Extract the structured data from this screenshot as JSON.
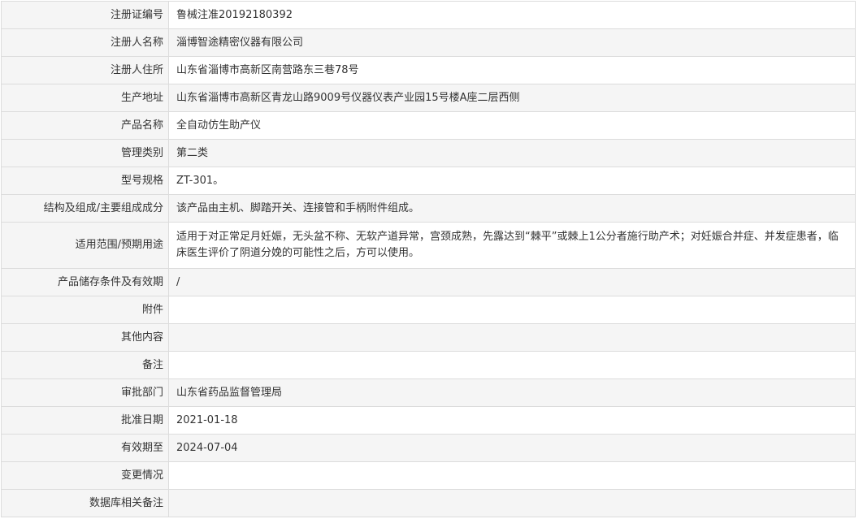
{
  "rows": [
    {
      "label": "注册证编号",
      "value": "鲁械注准20192180392"
    },
    {
      "label": "注册人名称",
      "value": "淄博智途精密仪器有限公司"
    },
    {
      "label": "注册人住所",
      "value": "山东省淄博市高新区南营路东三巷78号"
    },
    {
      "label": "生产地址",
      "value": "山东省淄博市高新区青龙山路9009号仪器仪表产业园15号楼A座二层西侧"
    },
    {
      "label": "产品名称",
      "value": "全自动仿生助产仪"
    },
    {
      "label": "管理类别",
      "value": "第二类"
    },
    {
      "label": "型号规格",
      "value": "ZT-301。"
    },
    {
      "label": "结构及组成/主要组成成分",
      "value": "该产品由主机、脚踏开关、连接管和手柄附件组成。"
    },
    {
      "label": "适用范围/预期用途",
      "value": "适用于对正常足月妊娠，无头盆不称、无软产道异常，宫颈成熟，先露达到“棘平”或棘上1公分者施行助产术；对妊娠合并症、并发症患者，临床医生评价了阴道分娩的可能性之后，方可以使用。"
    },
    {
      "label": "产品储存条件及有效期",
      "value": "/"
    },
    {
      "label": "附件",
      "value": ""
    },
    {
      "label": "其他内容",
      "value": ""
    },
    {
      "label": "备注",
      "value": ""
    },
    {
      "label": "审批部门",
      "value": "山东省药品监督管理局"
    },
    {
      "label": "批准日期",
      "value": "2021-01-18"
    },
    {
      "label": "有效期至",
      "value": "2024-07-04"
    },
    {
      "label": "变更情况",
      "value": ""
    },
    {
      "label": "数据库相关备注",
      "value": ""
    }
  ]
}
